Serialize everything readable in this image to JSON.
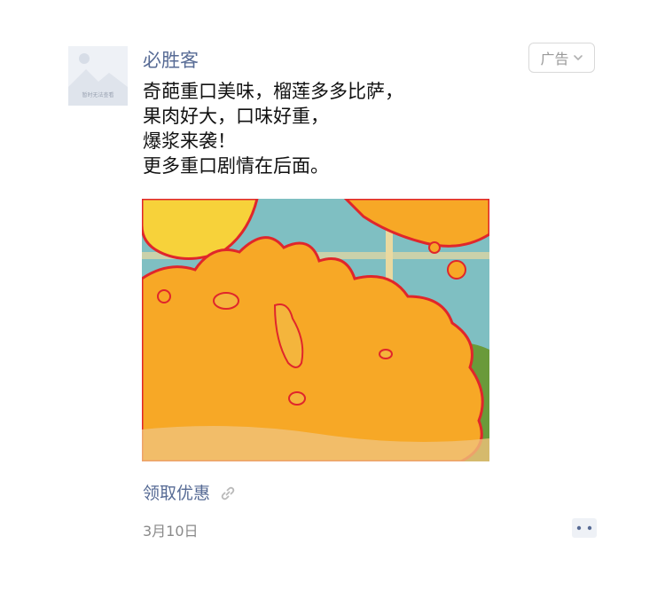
{
  "author": {
    "name": "必胜客",
    "avatar_caption": "暂时无法查看"
  },
  "ad_tag": {
    "label": "广告",
    "icon": "chevron-down-icon"
  },
  "post": {
    "lines": [
      "奇葩重口美味，榴莲多多比萨，",
      "果肉好大，口味好重，",
      "爆浆来袭！",
      "更多重口剧情在后面。"
    ],
    "image_icon": "durian-splash-image"
  },
  "cta": {
    "label": "领取优惠",
    "icon": "link-icon"
  },
  "meta": {
    "date": "3月10日",
    "comment_icon": "comment-icon"
  },
  "colors": {
    "link": "#576b95",
    "text": "#111111",
    "muted": "#8a8a8a",
    "splash": "#f7a826",
    "outline": "#e0262b"
  }
}
